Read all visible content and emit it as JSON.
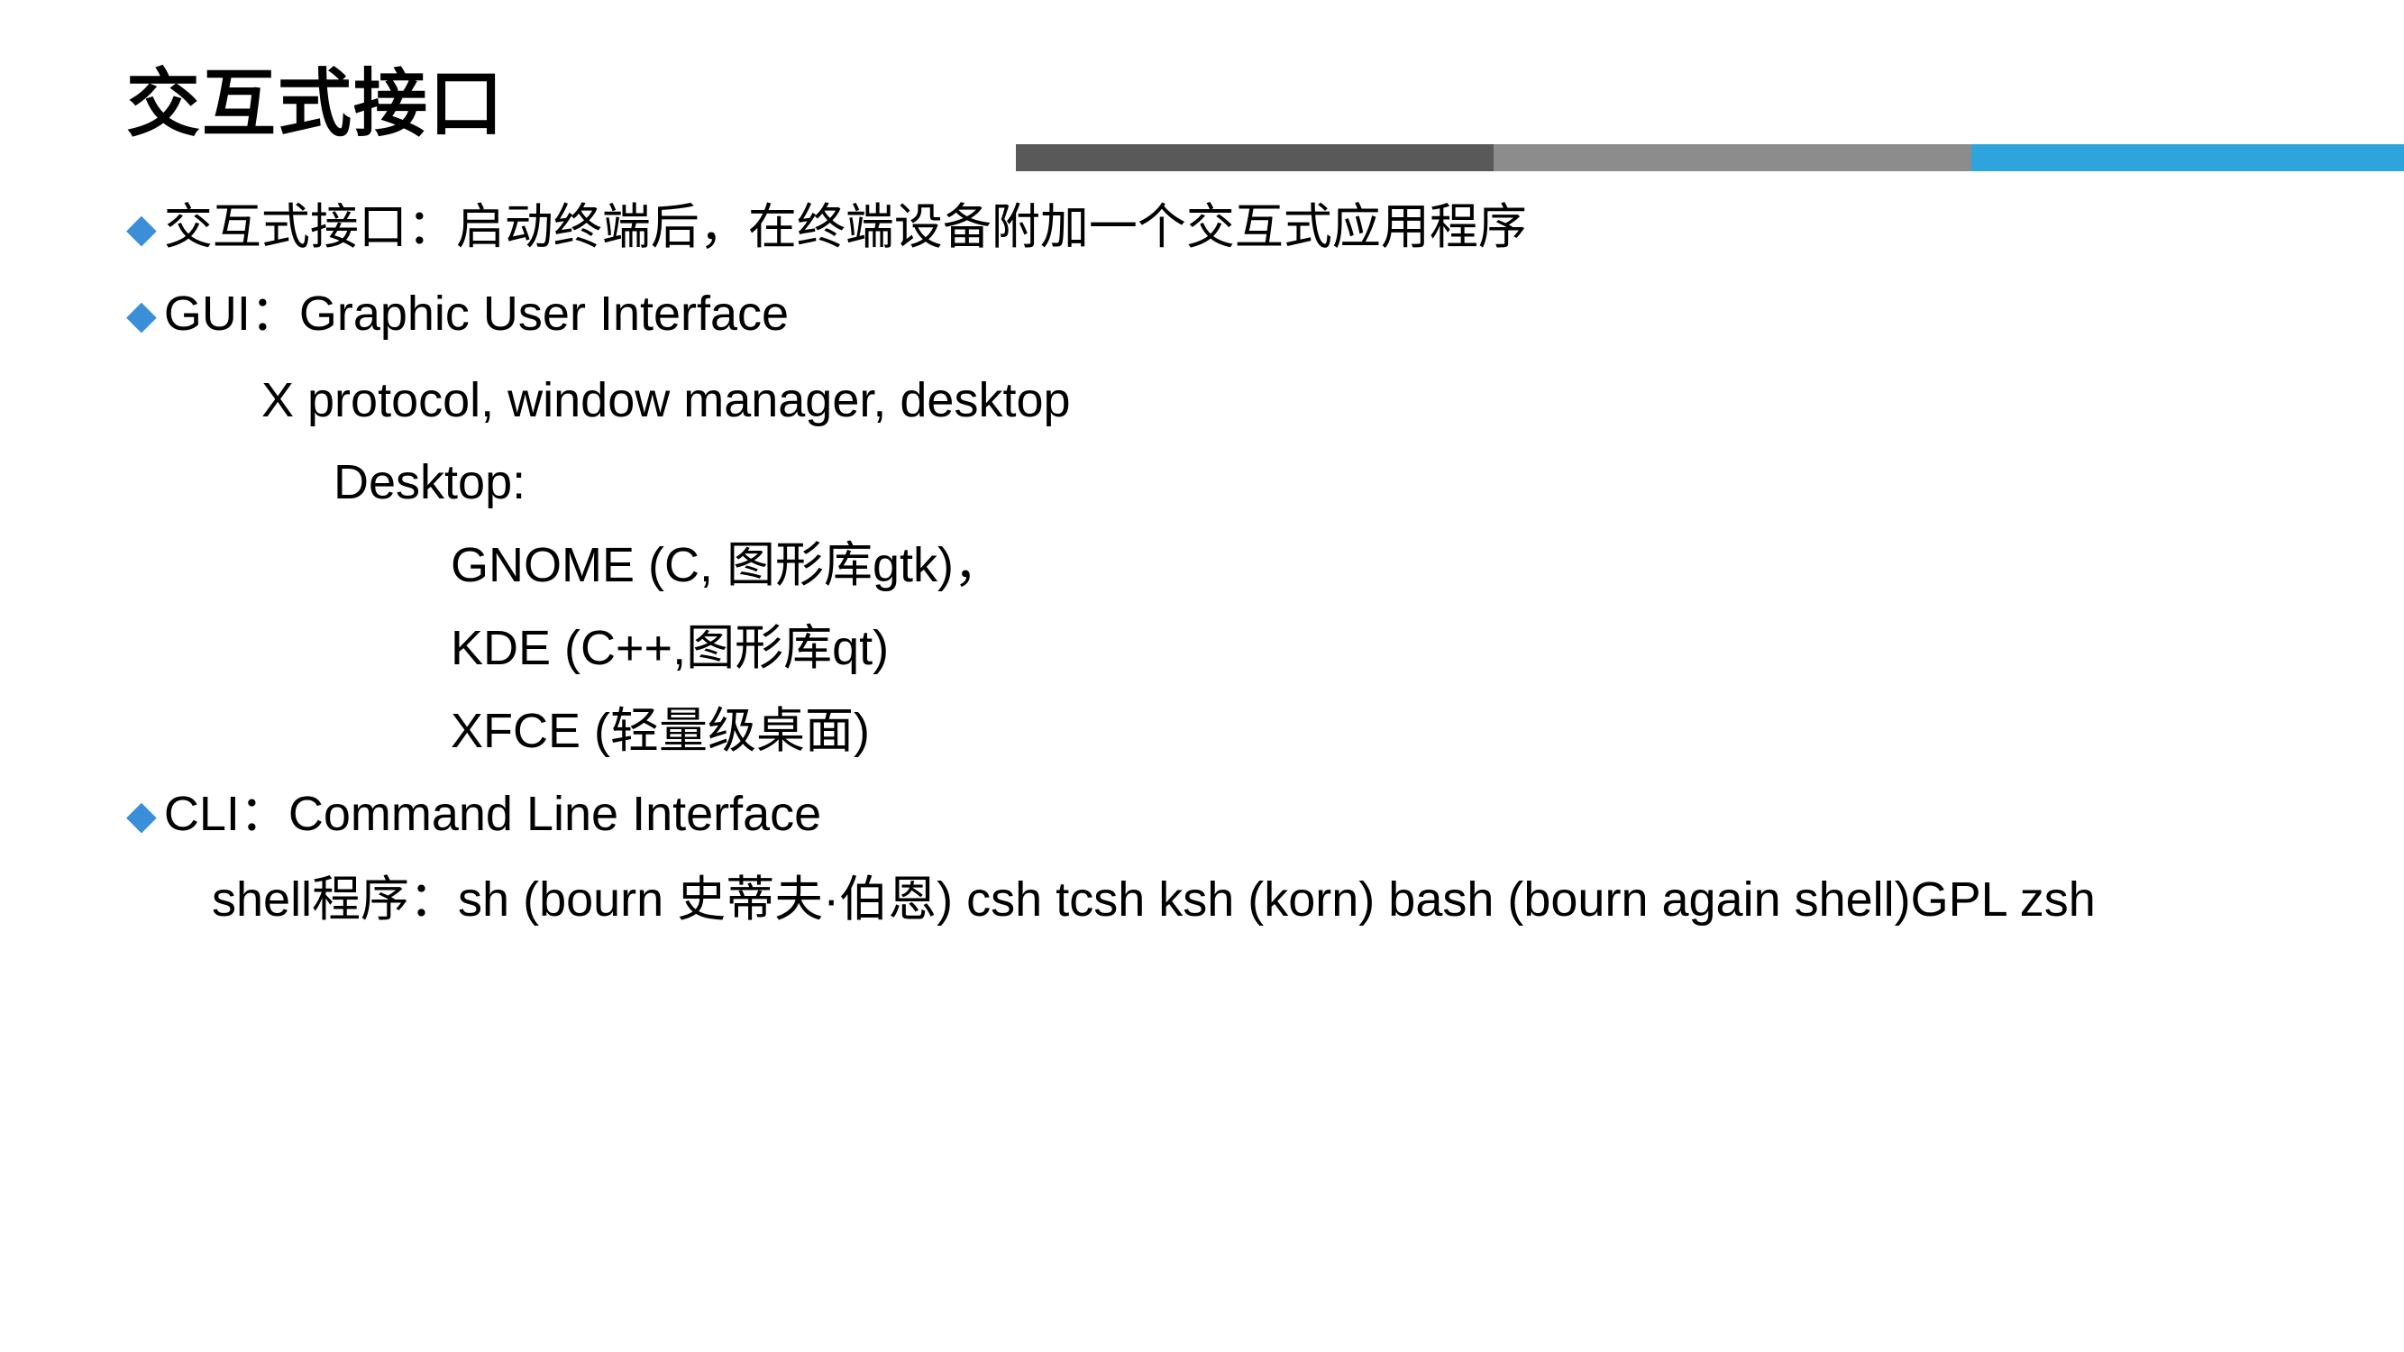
{
  "title": "交互式接口",
  "bullets": {
    "b1": "交互式接口：启动终端后，在终端设备附加一个交互式应用程序",
    "b2": "GUI：Graphic User Interface",
    "b2_sub1": "X protocol, window manager, desktop",
    "b2_sub2": "Desktop:",
    "b2_sub2_a": "GNOME (C, 图形库gtk)，",
    "b2_sub2_b": "KDE   (C++,图形库qt)",
    "b2_sub2_c": "XFCE  (轻量级桌面)",
    "b3": "CLI：Command Line Interface",
    "b3_sub1": "shell程序：sh (bourn 史蒂夫·伯恩) csh     tcsh    ksh (korn)     bash (bourn again shell)GPL  zsh"
  },
  "colors": {
    "diamond": "#3a8fd8",
    "bar_dark": "#595959",
    "bar_mid": "#8c8c8c",
    "bar_blue": "#2ea4dd"
  }
}
